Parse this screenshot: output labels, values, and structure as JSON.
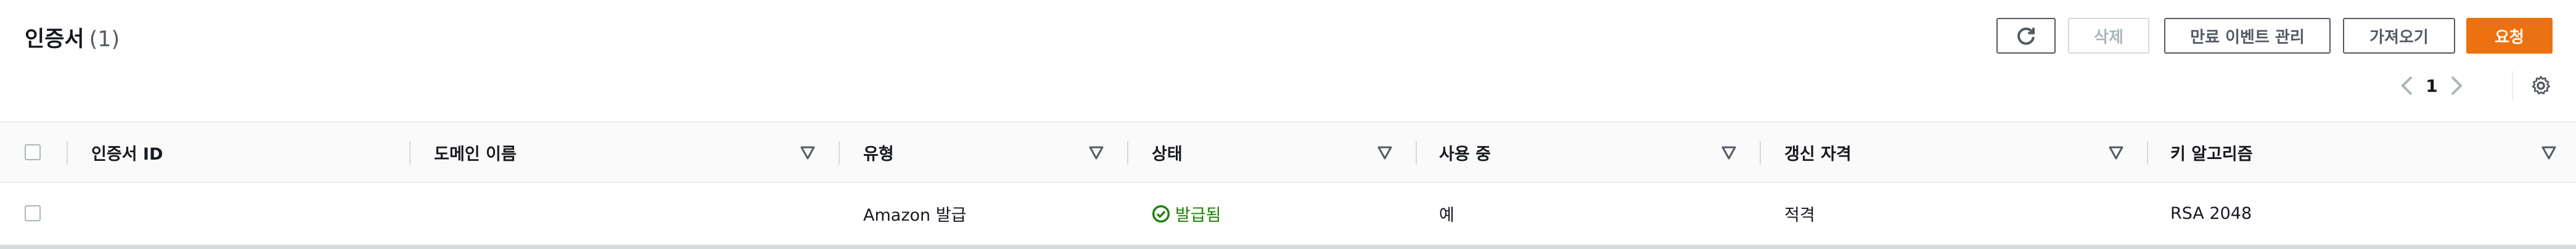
{
  "header": {
    "title": "인증서",
    "count": "(1)"
  },
  "toolbar": {
    "refresh_icon": "refresh-icon",
    "delete_label": "삭제",
    "expiry_events_label": "만료 이벤트 관리",
    "import_label": "가져오기",
    "request_label": "요청"
  },
  "pagination": {
    "current_page": "1",
    "prev_icon": "chevron-left-icon",
    "next_icon": "chevron-right-icon",
    "settings_icon": "gear-icon"
  },
  "table": {
    "columns": [
      {
        "label": "인증서 ID"
      },
      {
        "label": "도메인 이름"
      },
      {
        "label": "유형"
      },
      {
        "label": "상태"
      },
      {
        "label": "사용 중"
      },
      {
        "label": "갱신 자격"
      },
      {
        "label": "키 알고리즘"
      }
    ],
    "rows": [
      {
        "certificate_id": "",
        "domain_name": "",
        "type": "Amazon 발급",
        "status": "발급됨",
        "in_use": "예",
        "renewal_eligibility": "적격",
        "key_algorithm": "RSA 2048"
      }
    ]
  },
  "colors": {
    "primary_button": "#ec7211",
    "status_success": "#1d8102",
    "text": "#16191f",
    "border": "#eaeded"
  }
}
